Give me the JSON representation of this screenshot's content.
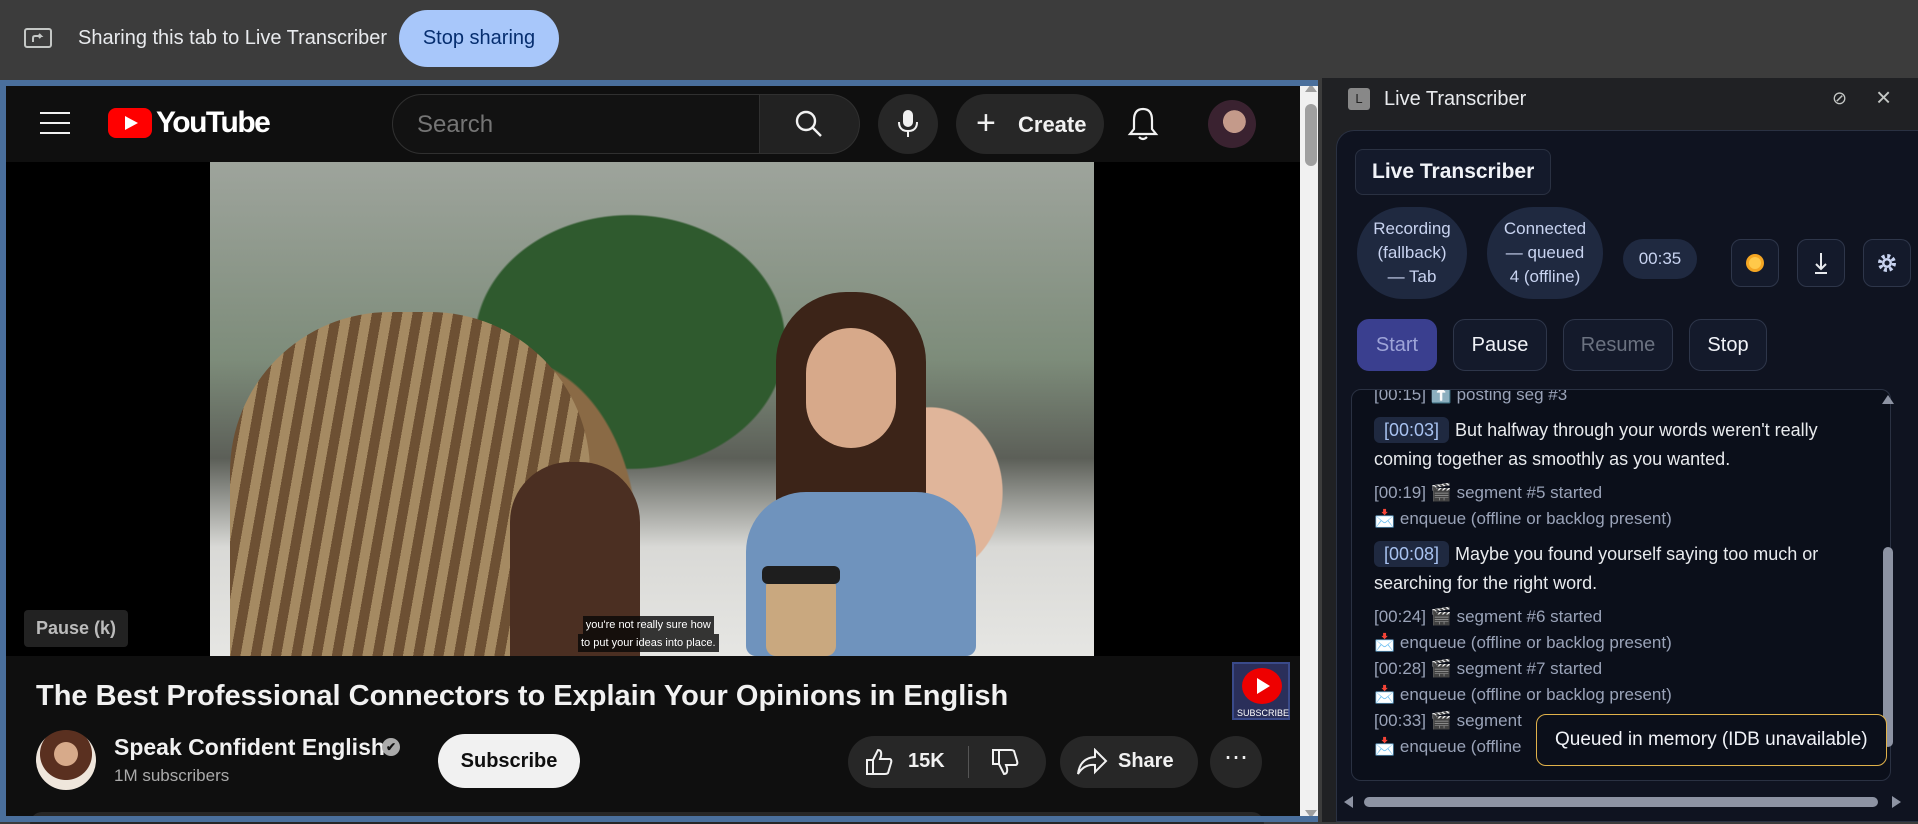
{
  "share_bar": {
    "text": "Sharing this tab to Live Transcriber",
    "stop_label": "Stop sharing"
  },
  "youtube": {
    "logo_text": "YouTube",
    "search_placeholder": "Search",
    "create_label": "Create",
    "video": {
      "caption_line1": "you're not really sure how",
      "caption_line2": "to put your ideas into place.",
      "pause_tooltip": "Pause (k)",
      "subscribe_badge": "SUBSCRIBE"
    },
    "title": "The Best Professional Connectors to Explain Your Opinions in English",
    "channel": {
      "name": "Speak Confident English",
      "verified_mark": "✔",
      "subscribers": "1M subscribers",
      "subscribe_label": "Subscribe"
    },
    "actions": {
      "like_count": "15K",
      "share_label": "Share",
      "more_label": "⋯"
    }
  },
  "panel": {
    "favicon_letter": "L",
    "title": "Live Transcriber",
    "app_title": "Live Transcriber",
    "status": {
      "recording_lines": [
        "Recording",
        "(fallback)",
        "— Tab"
      ],
      "connection_lines": [
        "Connected",
        "— queued",
        "4 (offline)"
      ],
      "elapsed": "00:35"
    },
    "controls": {
      "start": "Start",
      "pause": "Pause",
      "resume": "Resume",
      "stop": "Stop"
    },
    "log": [
      {
        "kind": "evt",
        "text": "[00:15] ⬆️ posting seg #3"
      },
      {
        "kind": "seg",
        "ts": "[00:03]",
        "text": "But halfway through your words weren't really",
        "text2": "coming together as smoothly as you wanted."
      },
      {
        "kind": "evt",
        "text": "[00:19] 🎬 segment #5 started"
      },
      {
        "kind": "evt",
        "text": "📩 enqueue (offline or backlog present)"
      },
      {
        "kind": "seg",
        "ts": "[00:08]",
        "text": "Maybe you found yourself saying too much or",
        "text2": "searching for the right word."
      },
      {
        "kind": "evt",
        "text": "[00:24] 🎬 segment #6 started"
      },
      {
        "kind": "evt",
        "text": "📩 enqueue (offline or backlog present)"
      },
      {
        "kind": "evt",
        "text": "[00:28] 🎬 segment #7 started"
      },
      {
        "kind": "evt",
        "text": "📩 enqueue (offline or backlog present)"
      },
      {
        "kind": "evt",
        "text": "[00:33] 🎬 segment"
      },
      {
        "kind": "evt",
        "text": "📩 enqueue (offline"
      }
    ],
    "tooltip": "Queued in memory (IDB unavailable)"
  }
}
